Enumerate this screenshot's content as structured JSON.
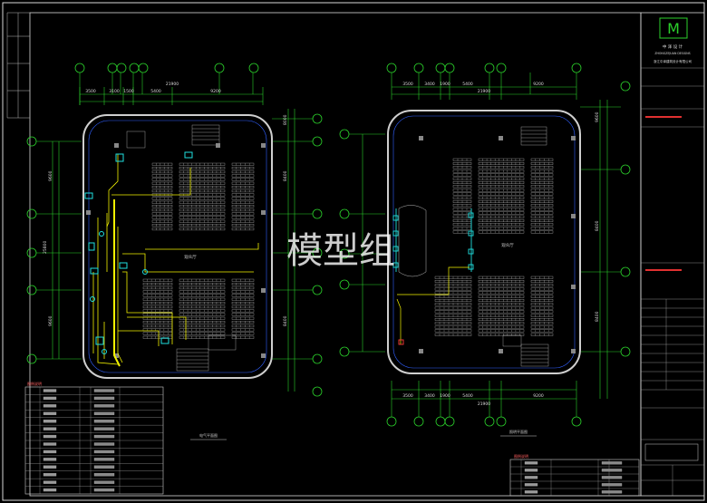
{
  "watermark": "模型组",
  "title_block": {
    "logo_glyph": "M",
    "company_cn": "中 泽 设 计",
    "company_en": "ZHONGZEJUAN DESIGNS",
    "company_full": "浙江中泽建筑设计有限公司"
  },
  "left_plan": {
    "top_dims": [
      "3500",
      "3100",
      "1500",
      "5400",
      "9200"
    ],
    "total_dim": "21900",
    "side_dims": [
      "9600",
      "25800",
      "9600"
    ],
    "right_dims": [
      "8000",
      "8400",
      "8400"
    ],
    "bottom_dim": "9200",
    "room_label": "观众厅",
    "plan_caption": "电气平面图"
  },
  "right_plan": {
    "top_dims": [
      "3500",
      "3400",
      "1900",
      "5400",
      "9200"
    ],
    "total_dim": "21900",
    "bottom_dims": [
      "3500",
      "3400",
      "1900",
      "5400",
      "9200"
    ],
    "bottom_total": "21900",
    "right_dims": [
      "9600",
      "8400",
      "8400"
    ],
    "room_label": "观众厅",
    "plan_caption": "照明平面图"
  },
  "legend_left": {
    "title": "图例说明",
    "rows": 9
  },
  "legend_right": {
    "title": "图例说明",
    "rows": 5
  },
  "colors": {
    "background": "#000000",
    "frame": "#d9d9d9",
    "wall": "#cfcfcf",
    "axis_bubble": "#2bd12b",
    "dim": "#2bd12b",
    "wire_yellow": "#f2f200",
    "equip_cyan": "#20e0e0",
    "seats": "#bfbfbf",
    "red": "#ff3b3b",
    "blue": "#3060ff"
  },
  "icons": [
    "company-logo-icon"
  ]
}
